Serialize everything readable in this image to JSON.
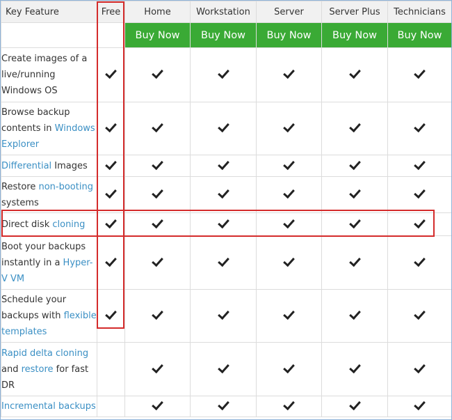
{
  "table": {
    "headers": [
      "Key Feature",
      "Free",
      "Home",
      "Workstation",
      "Server",
      "Server Plus",
      "Technicians"
    ],
    "buy_label": "Buy Now",
    "rows": [
      {
        "name": "live-os-images",
        "parts": [
          {
            "t": "Create images of a live/running Windows OS",
            "link": false
          }
        ],
        "checks": [
          true,
          true,
          true,
          true,
          true,
          true
        ]
      },
      {
        "name": "browse-backup",
        "parts": [
          {
            "t": "Browse backup contents in ",
            "link": false
          },
          {
            "t": "Windows Explorer",
            "link": true
          }
        ],
        "checks": [
          true,
          true,
          true,
          true,
          true,
          true
        ]
      },
      {
        "name": "differential-images",
        "parts": [
          {
            "t": "Differential",
            "link": true
          },
          {
            "t": " Images",
            "link": false
          }
        ],
        "checks": [
          true,
          true,
          true,
          true,
          true,
          true
        ]
      },
      {
        "name": "restore-non-booting",
        "parts": [
          {
            "t": "Restore ",
            "link": false
          },
          {
            "t": "non-booting",
            "link": true
          },
          {
            "t": " systems",
            "link": false
          }
        ],
        "checks": [
          true,
          true,
          true,
          true,
          true,
          true
        ]
      },
      {
        "name": "direct-disk-cloning",
        "parts": [
          {
            "t": "Direct disk ",
            "link": false
          },
          {
            "t": "cloning",
            "link": true
          }
        ],
        "checks": [
          true,
          true,
          true,
          true,
          true,
          true
        ]
      },
      {
        "name": "boot-backups-hyperv",
        "parts": [
          {
            "t": "Boot your backups instantly in a ",
            "link": false
          },
          {
            "t": "Hyper-V VM",
            "link": true
          }
        ],
        "checks": [
          true,
          true,
          true,
          true,
          true,
          true
        ]
      },
      {
        "name": "schedule-backups",
        "parts": [
          {
            "t": "Schedule your backups with ",
            "link": false
          },
          {
            "t": "flexible templates",
            "link": true
          }
        ],
        "checks": [
          true,
          true,
          true,
          true,
          true,
          true
        ]
      },
      {
        "name": "rapid-delta-cloning",
        "parts": [
          {
            "t": "Rapid delta cloning",
            "link": true
          },
          {
            "t": " and ",
            "link": false
          },
          {
            "t": "restore",
            "link": true
          },
          {
            "t": " for fast DR",
            "link": false
          }
        ],
        "checks": [
          false,
          true,
          true,
          true,
          true,
          true
        ]
      },
      {
        "name": "incremental-backups",
        "parts": [
          {
            "t": "Incremental backups",
            "link": true
          }
        ],
        "checks": [
          false,
          true,
          true,
          true,
          true,
          true
        ]
      }
    ]
  },
  "colors": {
    "buy_button": "#3aaa35",
    "header_bg": "#f1f1f1",
    "link": "#3a8fc4",
    "highlight": "#d42b2b"
  },
  "icons": {
    "check": "checkmark-icon"
  }
}
